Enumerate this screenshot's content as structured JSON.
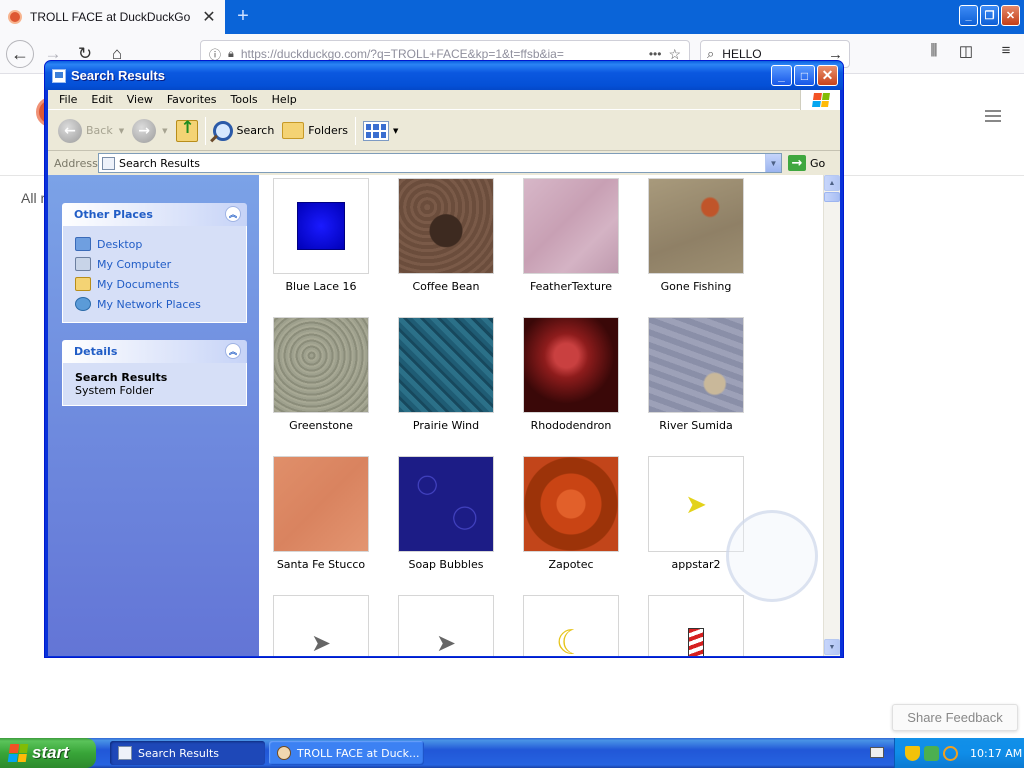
{
  "browser": {
    "tab_title": "TROLL FACE at DuckDuckGo",
    "tab_close": "✕",
    "new_tab": "+",
    "url": "https://duckduckgo.com/?q=TROLL+FACE&kp=1&t=ffsb&ia=",
    "search_value": "HELLO",
    "page_all_label": "All r",
    "share_feedback": "Share Feedback"
  },
  "explorer": {
    "title": "Search Results",
    "menu": [
      "File",
      "Edit",
      "View",
      "Favorites",
      "Tools",
      "Help"
    ],
    "toolbar": {
      "back": "Back",
      "search": "Search",
      "folders": "Folders"
    },
    "address_label": "Address",
    "address_value": "Search Results",
    "go_label": "Go",
    "other_places": {
      "title": "Other Places",
      "links": [
        "Desktop",
        "My Computer",
        "My Documents",
        "My Network Places"
      ]
    },
    "details": {
      "title": "Details",
      "name": "Search Results",
      "type": "System Folder"
    },
    "items": [
      {
        "label": "Blue Lace 16",
        "icon": "blue-lace-thumbnail"
      },
      {
        "label": "Coffee Bean",
        "icon": "coffee-bean-thumbnail"
      },
      {
        "label": "FeatherTexture",
        "icon": "feather-texture-thumbnail"
      },
      {
        "label": "Gone Fishing",
        "icon": "gone-fishing-thumbnail"
      },
      {
        "label": "Greenstone",
        "icon": "greenstone-thumbnail"
      },
      {
        "label": "Prairie Wind",
        "icon": "prairie-wind-thumbnail"
      },
      {
        "label": "Rhododendron",
        "icon": "rhododendron-thumbnail"
      },
      {
        "label": "River Sumida",
        "icon": "river-sumida-thumbnail"
      },
      {
        "label": "Santa Fe Stucco",
        "icon": "santa-fe-stucco-thumbnail"
      },
      {
        "label": "Soap Bubbles",
        "icon": "soap-bubbles-thumbnail"
      },
      {
        "label": "Zapotec",
        "icon": "zapotec-thumbnail"
      },
      {
        "label": "appstar2",
        "icon": "busy-cursor-thumbnail"
      }
    ]
  },
  "taskbar": {
    "start_label": "start",
    "tasks": [
      "Search Results",
      "TROLL FACE at Duck..."
    ],
    "clock": "10:17 AM"
  },
  "colors": {
    "xp_title_blue": "#0450d6",
    "taskpane_link": "#215dc6",
    "start_green": "#38a538",
    "ddg_orange": "#de5833"
  }
}
